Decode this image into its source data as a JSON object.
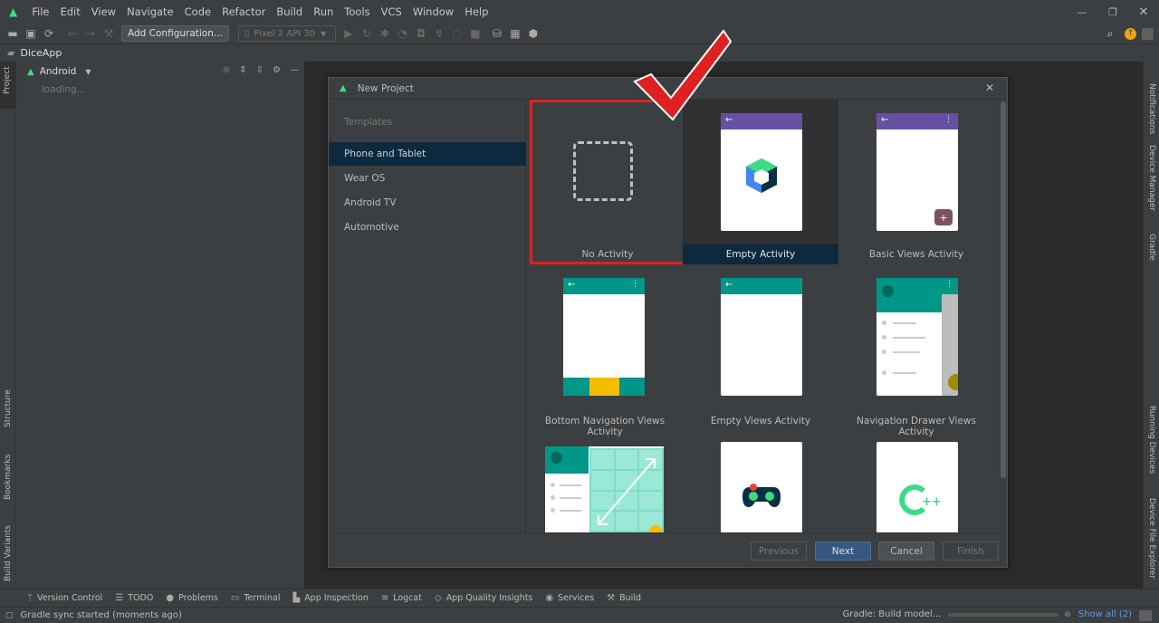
{
  "menubar": {
    "items": [
      "File",
      "Edit",
      "View",
      "Navigate",
      "Code",
      "Refactor",
      "Build",
      "Run",
      "Tools",
      "VCS",
      "Window",
      "Help"
    ]
  },
  "toolbar": {
    "add_config_label": "Add Configuration...",
    "device_label": "Pixel 2 API 30"
  },
  "nav": {
    "project_name": "DiceApp"
  },
  "project_panel": {
    "view_label": "Android",
    "loading_text": "loading..."
  },
  "left_strip": {
    "project_label": "Project",
    "structure_label": "Structure",
    "bookmarks_label": "Bookmarks",
    "build_variants_label": "Build Variants"
  },
  "right_strip": {
    "notifications_label": "Notifications",
    "device_manager_label": "Device Manager",
    "gradle_label": "Gradle",
    "running_devices_label": "Running Devices",
    "device_file_explorer_label": "Device File Explorer"
  },
  "dialog": {
    "title": "New Project",
    "templates_header": "Templates",
    "categories": [
      "Phone and Tablet",
      "Wear OS",
      "Android TV",
      "Automotive"
    ],
    "templates": [
      "No Activity",
      "Empty Activity",
      "Basic Views Activity",
      "Bottom Navigation Views Activity",
      "Empty Views Activity",
      "Navigation Drawer Views Activity"
    ],
    "buttons": {
      "previous": "Previous",
      "next": "Next",
      "cancel": "Cancel",
      "finish": "Finish"
    }
  },
  "bottom_tools": {
    "items": [
      "Version Control",
      "TODO",
      "Problems",
      "Terminal",
      "App Inspection",
      "Logcat",
      "App Quality Insights",
      "Services",
      "Build"
    ]
  },
  "status": {
    "left_text": "Gradle sync started (moments ago)",
    "right_text": "Gradle: Build model...",
    "show_all": "Show all (2)"
  },
  "colors": {
    "accent_purple": "#6750a4",
    "accent_teal": "#009688",
    "selected_blue": "#0d293e",
    "highlight_red": "#e02020"
  }
}
